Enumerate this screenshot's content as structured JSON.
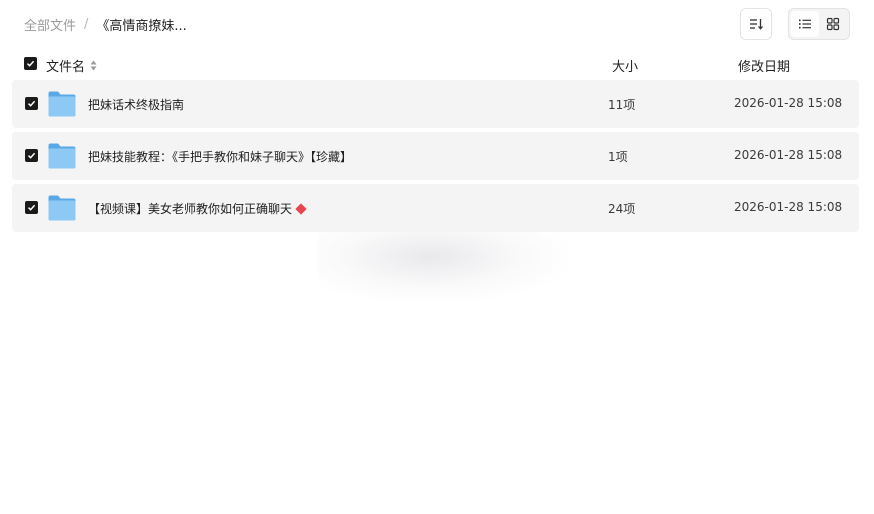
{
  "breadcrumb": {
    "root": "全部文件",
    "separator": "/",
    "current": "《高情商撩妹..."
  },
  "toolbar": {
    "sort_icon": "sort-icon",
    "view_modes": [
      {
        "name": "list",
        "icon": "list-view-icon",
        "active": true
      },
      {
        "name": "grid",
        "icon": "grid-view-icon",
        "active": false
      }
    ]
  },
  "table": {
    "headers": {
      "name": "文件名",
      "size": "大小",
      "date": "修改日期"
    },
    "select_all_checked": true,
    "rows": [
      {
        "name": "把妹话术终极指南",
        "size": "11项",
        "date": "2026-01-28 15:08",
        "checked": true,
        "icon": "folder-icon",
        "badge": ""
      },
      {
        "name": "把妹技能教程：《手把手教你和妹子聊天》【珍藏】",
        "size": "1项",
        "date": "2026-01-28 15:08",
        "checked": true,
        "icon": "folder-icon",
        "badge": ""
      },
      {
        "name": "【视频课】美女老师教你如何正确聊天",
        "size": "24项",
        "date": "2026-01-28 15:08",
        "checked": true,
        "icon": "folder-icon",
        "badge": "diamond-icon"
      }
    ]
  },
  "colors": {
    "row_bg": "#f4f4f5",
    "checkbox": "#1a1a1a",
    "folder": "#7cc0f2",
    "badge": "#e8454f",
    "muted_text": "#9a9a9a"
  }
}
